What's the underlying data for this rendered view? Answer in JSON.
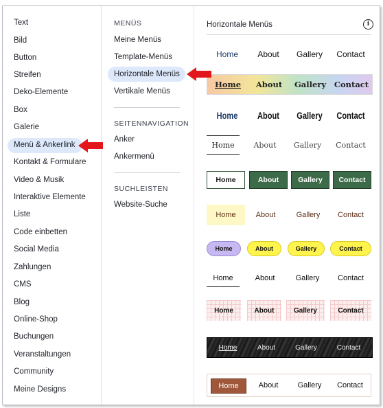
{
  "sidebar": {
    "items": [
      "Text",
      "Bild",
      "Button",
      "Streifen",
      "Deko-Elemente",
      "Box",
      "Galerie",
      "Menü & Ankerlink",
      "Kontakt & Formulare",
      "Video & Musik",
      "Interaktive Elemente",
      "Liste",
      "Code einbetten",
      "Social Media",
      "Zahlungen",
      "CMS",
      "Blog",
      "Online-Shop",
      "Buchungen",
      "Veranstaltungen",
      "Community",
      "Meine Designs"
    ],
    "selected_index": 7
  },
  "submenu": {
    "menus_heading": "MENÜS",
    "menus": [
      "Meine Menüs",
      "Template-Menüs",
      "Horizontale Menüs",
      "Vertikale Menüs"
    ],
    "selected_index": 2,
    "nav_heading": "SEITENNAVIGATION",
    "nav": [
      "Anker",
      "Ankermenü"
    ],
    "search_heading": "SUCHLEISTEN",
    "search": [
      "Website-Suche"
    ]
  },
  "panel": {
    "title": "Horizontale Menüs",
    "info_icon": "info-icon",
    "menu_items": [
      "Home",
      "About",
      "Gallery",
      "Contact"
    ]
  },
  "colors": {
    "selection_bg": "#dde9fb",
    "arrow": "#e3171b",
    "green": "#3d6b4a",
    "purple": "#c8b8f2",
    "yellow": "#fff34d",
    "brown": "#a0583a"
  }
}
